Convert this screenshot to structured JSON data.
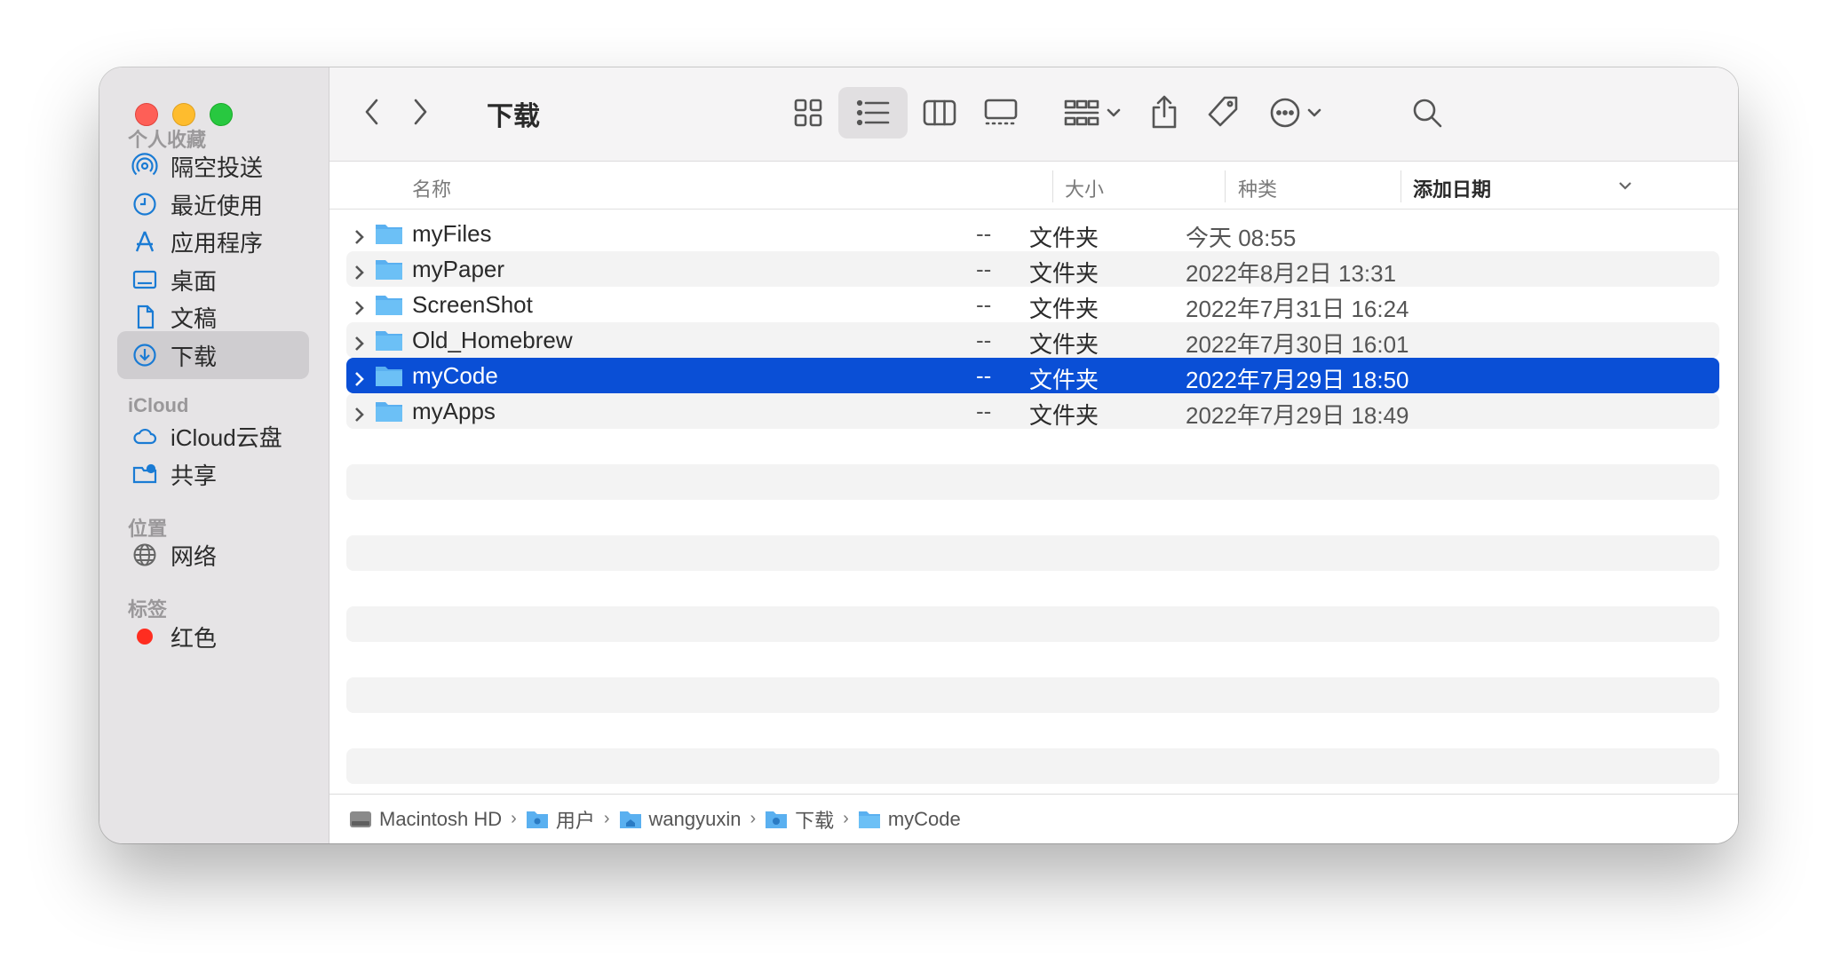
{
  "window": {
    "title": "下载"
  },
  "sidebar": {
    "sections": [
      {
        "label": "个人收藏"
      },
      {
        "label": "iCloud"
      },
      {
        "label": "位置"
      },
      {
        "label": "标签"
      }
    ],
    "favorites": [
      {
        "label": "隔空投送",
        "icon": "airdrop-icon"
      },
      {
        "label": "最近使用",
        "icon": "clock-icon"
      },
      {
        "label": "应用程序",
        "icon": "applications-icon"
      },
      {
        "label": "桌面",
        "icon": "desktop-icon"
      },
      {
        "label": "文稿",
        "icon": "document-icon"
      },
      {
        "label": "下载",
        "icon": "download-icon",
        "active": true
      }
    ],
    "icloud": [
      {
        "label": "iCloud云盘",
        "icon": "cloud-icon"
      },
      {
        "label": "共享",
        "icon": "shared-folder-icon"
      }
    ],
    "locations": [
      {
        "label": "网络",
        "icon": "globe-icon"
      }
    ],
    "tags": [
      {
        "label": "红色",
        "color": "#ff2d20"
      }
    ]
  },
  "header": {
    "name": "名称",
    "size": "大小",
    "kind": "种类",
    "date_added": "添加日期"
  },
  "files": [
    {
      "name": "myFiles",
      "size": "--",
      "kind": "文件夹",
      "date": "今天 08:55"
    },
    {
      "name": "myPaper",
      "size": "--",
      "kind": "文件夹",
      "date": "2022年8月2日 13:31"
    },
    {
      "name": "ScreenShot",
      "size": "--",
      "kind": "文件夹",
      "date": "2022年7月31日 16:24"
    },
    {
      "name": "Old_Homebrew",
      "size": "--",
      "kind": "文件夹",
      "date": "2022年7月30日 16:01"
    },
    {
      "name": "myCode",
      "size": "--",
      "kind": "文件夹",
      "date": "2022年7月29日 18:50",
      "selected": true
    },
    {
      "name": "myApps",
      "size": "--",
      "kind": "文件夹",
      "date": "2022年7月29日 18:49"
    }
  ],
  "pathbar": [
    {
      "label": "Macintosh HD",
      "icon": "harddisk-icon"
    },
    {
      "label": "用户",
      "icon": "users-folder-icon"
    },
    {
      "label": "wangyuxin",
      "icon": "home-folder-icon"
    },
    {
      "label": "下载",
      "icon": "downloads-folder-icon"
    },
    {
      "label": "myCode",
      "icon": "folder-icon"
    }
  ],
  "colors": {
    "selection": "#0a4fd6",
    "folder": "#5ab0f0",
    "accent_icon": "#1a7bd4"
  }
}
